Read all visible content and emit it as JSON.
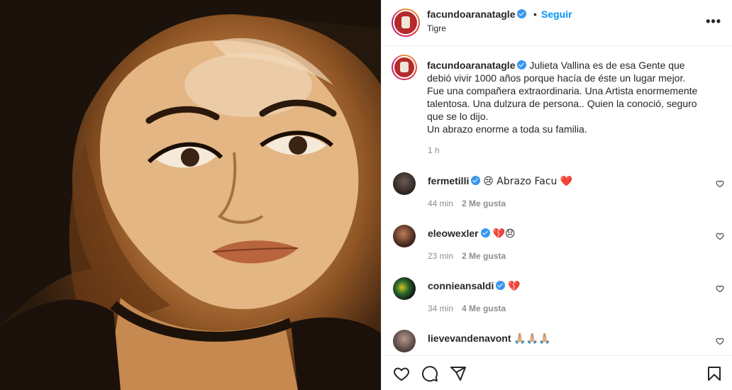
{
  "post": {
    "username": "facundoaranatagle",
    "verified": true,
    "separator": "•",
    "follow_label": "Seguir",
    "location": "Tigre",
    "more_label": "•••"
  },
  "caption": {
    "username": "facundoaranatagle",
    "text_lines": [
      "Julieta Vallina es de esa Gente que",
      "debió vivir 1000 años porque hacía de éste un lugar mejor.",
      "Fue una compañera extraordinaria. Una Artista enormemente",
      "talentosa. Una dulzura de persona.. Quien la conoció, seguro",
      "que se lo dijo.",
      "Un abrazo enorme a toda su familia."
    ],
    "time": "1 h"
  },
  "comments": [
    {
      "username": "fermetilli",
      "text": "😢 Abrazo Facu ❤️",
      "time": "44 min",
      "likes": "2 Me gusta"
    },
    {
      "username": "eleowexler",
      "text": "💔😞",
      "time": "23 min",
      "likes": "2 Me gusta"
    },
    {
      "username": "connieansaldi",
      "text": "💔",
      "time": "34 min",
      "likes": "4 Me gusta"
    },
    {
      "username": "lievevandenavont",
      "text": "🙏🏼🙏🏼🙏🏼",
      "time": "",
      "likes": ""
    }
  ],
  "icons": {
    "like": "heart-icon",
    "comment": "comment-icon",
    "share": "share-icon",
    "save": "bookmark-icon",
    "more": "more-icon",
    "verified": "verified-icon"
  },
  "colors": {
    "link_blue": "#0095f6",
    "verified_blue": "#3897f0",
    "muted": "#8e8e8e",
    "text": "#262626"
  }
}
